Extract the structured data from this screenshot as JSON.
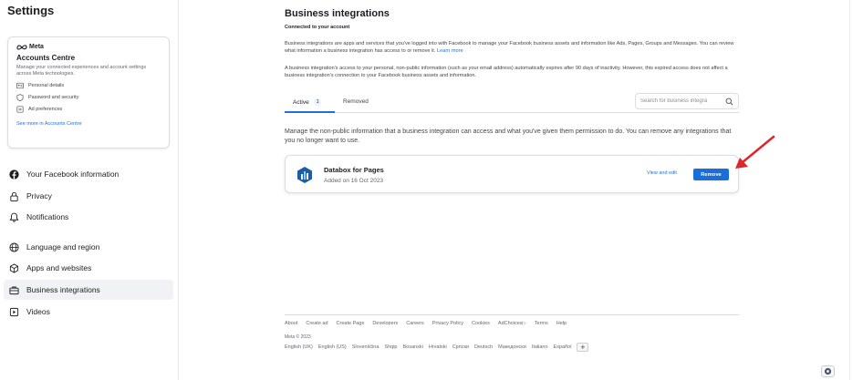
{
  "sidebar": {
    "title": "Settings",
    "accounts_centre": {
      "brand": "Meta",
      "title": "Accounts Centre",
      "description": "Manage your connected experiences and account settings across Meta technologies.",
      "items": [
        {
          "label": "Personal details",
          "icon": "id-card-icon"
        },
        {
          "label": "Password and security",
          "icon": "shield-icon"
        },
        {
          "label": "Ad preferences",
          "icon": "ad-icon"
        }
      ],
      "link": "See more in Accounts Centre"
    },
    "nav": [
      {
        "label": "Your Facebook information",
        "icon": "facebook-icon"
      },
      {
        "label": "Privacy",
        "icon": "lock-icon"
      },
      {
        "label": "Notifications",
        "icon": "bell-icon"
      },
      {
        "label": "Language and region",
        "icon": "globe-icon"
      },
      {
        "label": "Apps and websites",
        "icon": "cube-icon"
      },
      {
        "label": "Business integrations",
        "icon": "briefcase-icon",
        "active": true
      },
      {
        "label": "Videos",
        "icon": "video-icon"
      }
    ]
  },
  "main": {
    "title": "Business integrations",
    "subtitle": "Connected to your account",
    "para1": "Business integrations are apps and services that you've logged into with Facebook to manage your Facebook business assets and information like Ads, Pages, Groups and Messages. You can review what information a business integration has access to or remove it.",
    "para1_link": "Learn more",
    "para2": "A business integration's access to your personal, non-public information (such as your email address) automatically expires after 90 days of inactivity. However, this expired access does not affect a business integration's connection to your Facebook business assets and information.",
    "tabs": [
      {
        "label": "Active",
        "count": "1"
      },
      {
        "label": "Removed"
      }
    ],
    "search_placeholder": "Search for business integra",
    "manage_text": "Manage the non-public information that a business integration can access and what you've given them permission to do. You can remove any integrations that you no longer want to use.",
    "integration": {
      "name": "Databox for Pages",
      "added": "Added on 16 Oct 2023",
      "view_edit": "View and edit",
      "remove": "Remove"
    }
  },
  "footer": {
    "links": [
      "About",
      "Create ad",
      "Create Page",
      "Developers",
      "Careers",
      "Privacy Policy",
      "Cookies",
      "AdChoices",
      "Terms",
      "Help"
    ],
    "copyright": "Meta © 2023",
    "languages": [
      "English (UK)",
      "English (US)",
      "Slovenščina",
      "Shqip",
      "Bosanski",
      "Hrvatski",
      "Српски",
      "Deutsch",
      "Македонски",
      "Italiano",
      "Español"
    ],
    "more_languages": "+"
  },
  "colors": {
    "accent": "#1a6ed8",
    "annotation_arrow": "#e0262b"
  }
}
